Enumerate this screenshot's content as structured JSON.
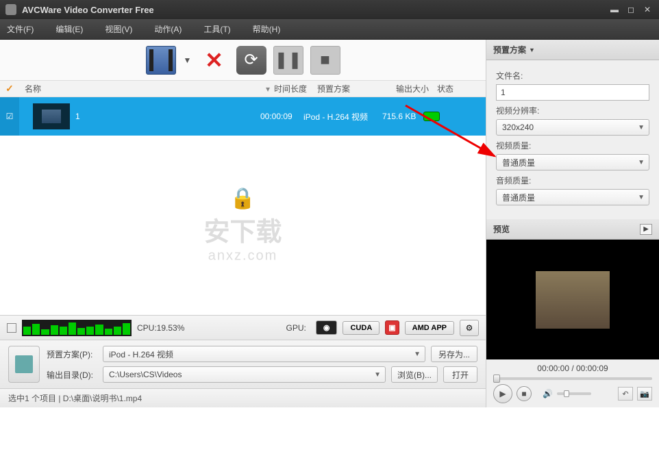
{
  "app": {
    "title": "AVCWare Video Converter Free"
  },
  "menu": {
    "file": "文件(F)",
    "edit": "编辑(E)",
    "view": "视图(V)",
    "action": "动作(A)",
    "tools": "工具(T)",
    "help": "帮助(H)"
  },
  "columns": {
    "name": "名称",
    "duration": "时间长度",
    "profile": "预置方案",
    "size": "输出大小",
    "status": "状态"
  },
  "file": {
    "name": "1",
    "duration": "00:00:09",
    "profile": "iPod - H.264 视频",
    "size": "715.6 KB"
  },
  "watermark": {
    "big": "安下载",
    "small": "anxz.com"
  },
  "cpu": {
    "label": "CPU:",
    "value": "19.53%"
  },
  "gpu": {
    "label": "GPU:",
    "cuda": "CUDA",
    "amd": "AMD APP"
  },
  "profile_panel": {
    "profile_label": "预置方案(P):",
    "profile_value": "iPod - H.264 视频",
    "save_as": "另存为...",
    "output_label": "输出目录(D):",
    "output_value": "C:\\Users\\CS\\Videos",
    "browse": "浏览(B)...",
    "open": "打开"
  },
  "statusbar": "选中1 个项目 | D:\\桌面\\说明书\\1.mp4",
  "right": {
    "header": "预置方案",
    "filename_label": "文件名:",
    "filename": "1",
    "resolution_label": "视频分辨率:",
    "resolution": "320x240",
    "vquality_label": "视频质量:",
    "vquality": "普通质量",
    "aquality_label": "音频质量:",
    "aquality": "普通质量",
    "preview_header": "预览",
    "time": "00:00:00 / 00:00:09"
  }
}
